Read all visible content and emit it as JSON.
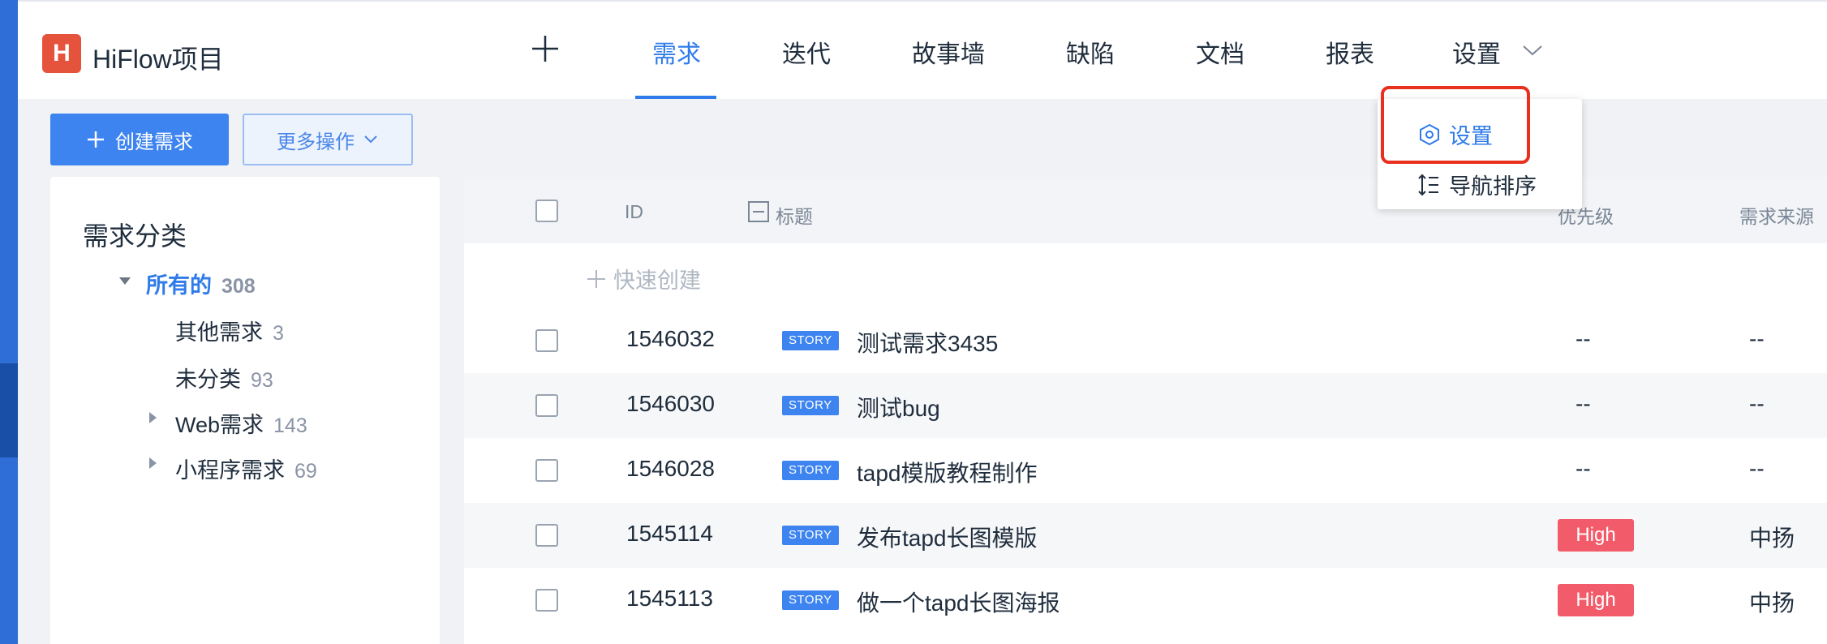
{
  "app": {
    "logo_letter": "H",
    "project_name": "HiFlow项目"
  },
  "nav": {
    "tabs": [
      {
        "label": "需求",
        "active": true
      },
      {
        "label": "迭代",
        "active": false
      },
      {
        "label": "故事墙",
        "active": false
      },
      {
        "label": "缺陷",
        "active": false
      },
      {
        "label": "文档",
        "active": false
      },
      {
        "label": "报表",
        "active": false
      },
      {
        "label": "设置",
        "active": false
      }
    ]
  },
  "dropdown": {
    "items": [
      {
        "label": "设置",
        "icon": "hexagon-settings-icon",
        "highlighted": true
      },
      {
        "label": "导航排序",
        "icon": "sort-icon",
        "highlighted": false
      }
    ]
  },
  "toolbar": {
    "create_label": "创建需求",
    "more_label": "更多操作"
  },
  "sidebar": {
    "title": "需求分类",
    "items": [
      {
        "label": "所有的",
        "count": "308",
        "active": true,
        "expanded": true
      },
      {
        "label": "其他需求",
        "count": "3"
      },
      {
        "label": "未分类",
        "count": "93"
      },
      {
        "label": "Web需求",
        "count": "143",
        "has_children": true
      },
      {
        "label": "小程序需求",
        "count": "69",
        "has_children": true
      }
    ]
  },
  "table": {
    "columns": {
      "id": "ID",
      "title": "标题",
      "priority": "优先级",
      "source": "需求来源"
    },
    "quick_create": "快速创建",
    "rows": [
      {
        "id": "1546032",
        "tag": "STORY",
        "title": "测试需求3435",
        "priority": "--",
        "source": "--"
      },
      {
        "id": "1546030",
        "tag": "STORY",
        "title": "测试bug",
        "priority": "--",
        "source": "--"
      },
      {
        "id": "1546028",
        "tag": "STORY",
        "title": "tapd模版教程制作",
        "priority": "--",
        "source": "--"
      },
      {
        "id": "1545114",
        "tag": "STORY",
        "title": "发布tapd长图模版",
        "priority": "High",
        "source": "中扬"
      },
      {
        "id": "1545113",
        "tag": "STORY",
        "title": "做一个tapd长图海报",
        "priority": "High",
        "source": "中扬"
      }
    ]
  },
  "colors": {
    "accent": "#2f7bea",
    "high_badge": "#f25c6a",
    "highlight_box": "#e8301f",
    "logo": "#e5533d"
  }
}
